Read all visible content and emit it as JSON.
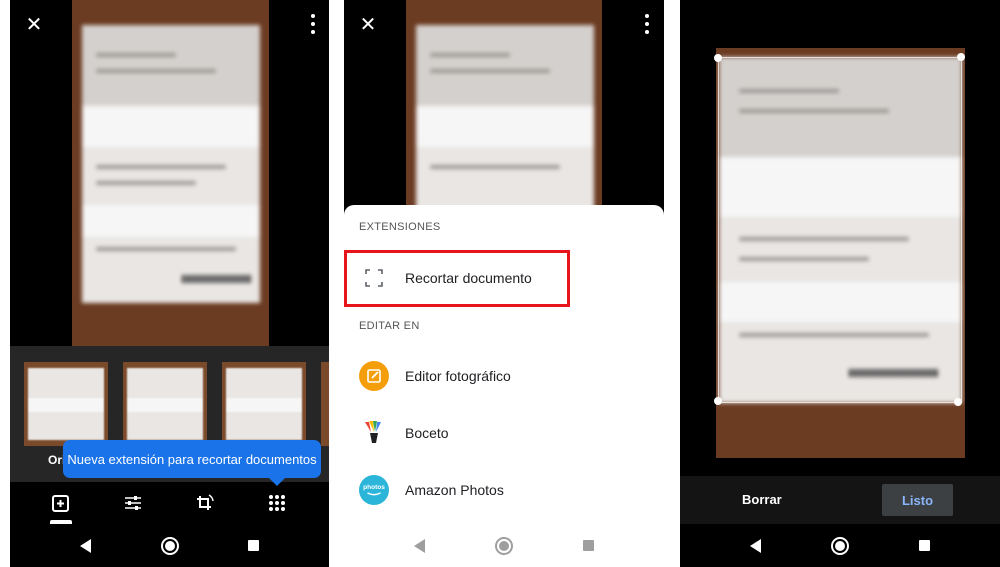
{
  "panel1": {
    "thumbnail_label": "Ori",
    "tooltip": "Nueva extensión para recortar documentos",
    "tools": [
      "add-photo-icon",
      "sliders-icon",
      "rotate-crop-icon",
      "grid-dots-icon"
    ]
  },
  "panel2": {
    "section_extensions": "EXTENSIONES",
    "section_edit_in": "EDITAR EN",
    "items": [
      {
        "label": "Recortar documento",
        "icon": "crop-document-icon"
      },
      {
        "label": "Editor fotográfico",
        "icon": "photo-editor-icon"
      },
      {
        "label": "Boceto",
        "icon": "sketch-icon"
      },
      {
        "label": "Amazon Photos",
        "icon": "amazon-photos-icon",
        "icon_text": "photos"
      }
    ],
    "highlight_color": "#e8141b"
  },
  "panel3": {
    "clear_label": "Borrar",
    "done_label": "Listo"
  },
  "colors": {
    "accent": "#1a73e8",
    "done_text": "#8ab4f8"
  }
}
